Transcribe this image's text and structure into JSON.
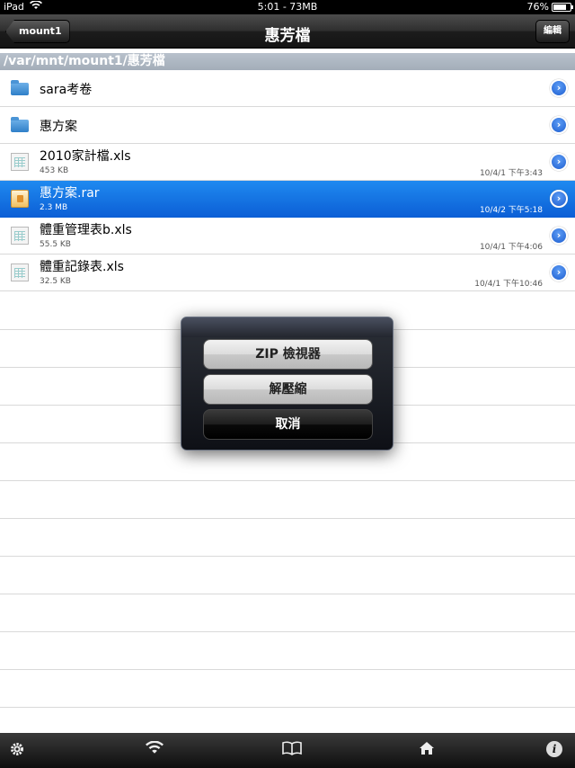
{
  "status_bar": {
    "device": "iPad",
    "center": "5:01 - 73MB",
    "battery_text": "76%",
    "battery_level": 0.76
  },
  "nav": {
    "back_label": "mount1",
    "title": "惠芳檔",
    "edit_label": "編輯"
  },
  "path": "/var/mnt/mount1/惠芳檔",
  "files": [
    {
      "name": "sara考卷",
      "type": "folder",
      "size": "",
      "date": ""
    },
    {
      "name": "惠方案",
      "type": "folder",
      "size": "",
      "date": ""
    },
    {
      "name": "2010家計檔.xls",
      "type": "sheet",
      "size": "453 KB",
      "date": "10/4/1 下午3:43"
    },
    {
      "name": "惠方案.rar",
      "type": "archive",
      "size": "2.3 MB",
      "date": "10/4/2 下午5:18"
    },
    {
      "name": "體重管理表b.xls",
      "type": "sheet",
      "size": "55.5 KB",
      "date": "10/4/1 下午4:06"
    },
    {
      "name": "體重記錄表.xls",
      "type": "sheet",
      "size": "32.5 KB",
      "date": "10/4/1 下午10:46"
    }
  ],
  "action_sheet": {
    "zip_viewer": "ZIP 檢視器",
    "extract": "解壓縮",
    "cancel": "取消"
  },
  "tab_bar": {
    "icons": [
      "gear-icon",
      "wifi-icon",
      "book-icon",
      "home-icon",
      "info-icon"
    ]
  }
}
